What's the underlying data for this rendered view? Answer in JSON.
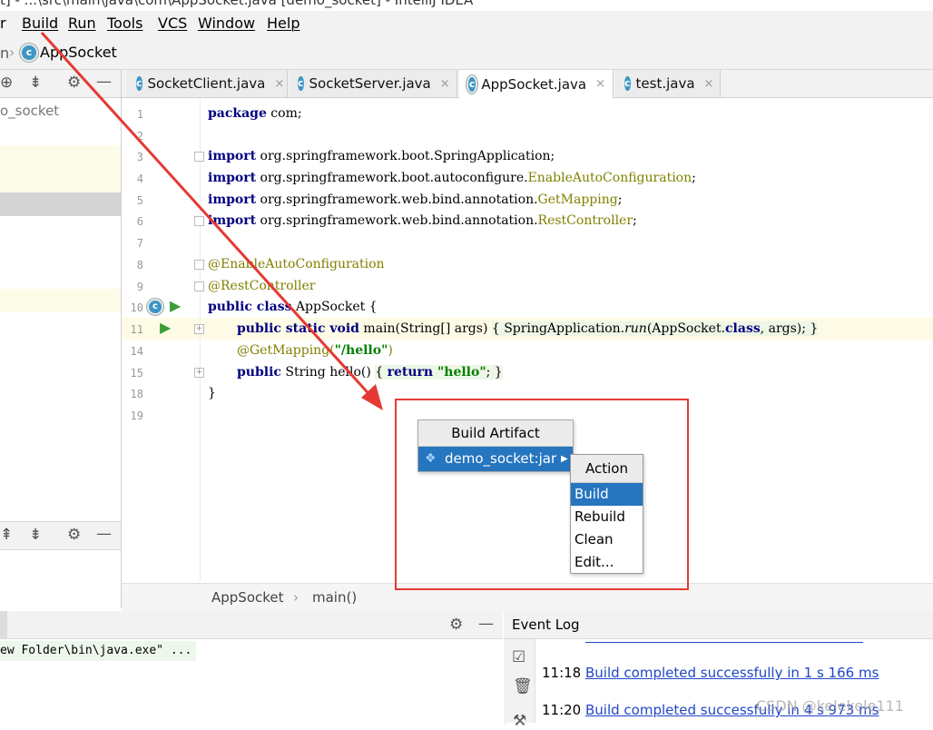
{
  "window_title": "t] - ...\\src\\main\\java\\com\\AppSocket.java [demo_socket] - IntelliJ IDEA",
  "menu": [
    "r",
    "Build",
    "Run",
    "Tools",
    "VCS",
    "Window",
    "Help"
  ],
  "nav": {
    "chevron": "n",
    "file": "AppSocket"
  },
  "project_panel": {
    "root": "o_socket"
  },
  "tabs": [
    {
      "label": "SocketClient.java",
      "active": false
    },
    {
      "label": "SocketServer.java",
      "active": false
    },
    {
      "label": "AppSocket.java",
      "active": true
    },
    {
      "label": "test.java",
      "active": false
    }
  ],
  "close_glyph": "×",
  "code": {
    "line_numbers": [
      "1",
      "2",
      "3",
      "4",
      "5",
      "6",
      "7",
      "8",
      "9",
      "10",
      "11",
      "14",
      "15",
      "18",
      "19"
    ],
    "l1_kw": "package",
    "l1_rest": " com;",
    "imports": [
      {
        "kw": "import",
        "pkg": " org.springframework.boot.",
        "cls": "SpringApplication",
        "tail": ";"
      },
      {
        "kw": "import",
        "pkg": " org.springframework.boot.autoconfigure.",
        "cls": "EnableAutoConfiguration",
        "tail": ";"
      },
      {
        "kw": "import",
        "pkg": " org.springframework.web.bind.annotation.",
        "cls": "GetMapping",
        "tail": ";"
      },
      {
        "kw": "import",
        "pkg": " org.springframework.web.bind.annotation.",
        "cls": "RestController",
        "tail": ";"
      }
    ],
    "ann1": "@EnableAutoConfiguration",
    "ann2": "@RestController",
    "class_kw": "public class",
    "class_name": " AppSocket {",
    "main_kw": "public static void",
    "main_sig": " main(String[] args) ",
    "main_body_open": "{ SpringApplication.",
    "main_run": "run",
    "main_body_mid": "(AppSocket.",
    "main_class_kw": "class",
    "main_body_end": ", args); }",
    "getmapping": "@GetMapping(",
    "hello_path": "\"/hello\"",
    "getmapping_end": ")",
    "hello_kw": "public",
    "hello_sig": " String hello() ",
    "hello_open": "{ ",
    "hello_ret": "return",
    "hello_str": " \"hello\"",
    "hello_end": "; }",
    "close_brace": "}"
  },
  "breadcrumb": {
    "class": "AppSocket",
    "sep": "›",
    "method": "main()"
  },
  "run_console": "ew Folder\\bin\\java.exe\" ...",
  "event_log": {
    "title": "Event Log",
    "entries": [
      {
        "time": "11:18",
        "message": "Build completed successfully in 1 s 166 ms"
      },
      {
        "time": "11:20",
        "message": "Build completed successfully in 4 s 973 ms"
      }
    ]
  },
  "artifact_popup": {
    "title": "Build Artifact",
    "item": "demo_socket:jar"
  },
  "action_popup": {
    "title": "Action",
    "items": [
      "Build",
      "Rebuild",
      "Clean",
      "Edit..."
    ],
    "selected_index": 0
  },
  "watermark": "CSDN @kelekele111",
  "colors": {
    "annotation_red": "#e53935",
    "selection_blue": "#2675bf",
    "link_blue": "#2046c8"
  }
}
